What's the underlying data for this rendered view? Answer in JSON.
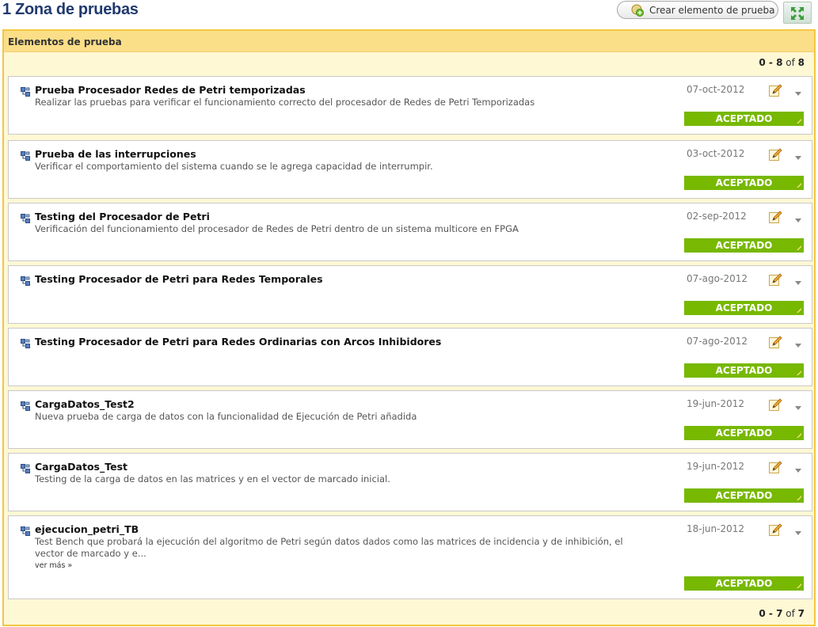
{
  "header": {
    "title": "1 Zona de pruebas",
    "create_button_label": "Crear elemento de prueba"
  },
  "panel": {
    "title": "Elementos de prueba",
    "pager_top": {
      "start": "0",
      "sep": " - ",
      "end": "8",
      "of": " of ",
      "total": "8"
    },
    "pager_bottom": {
      "start": "0",
      "sep": " - ",
      "end": "7",
      "of": " of ",
      "total": "7"
    }
  },
  "items": [
    {
      "title": "Prueba Procesador Redes de Petri temporizadas",
      "description": "Realizar las pruebas para verificar el funcionamiento correcto del procesador de Redes de Petri Temporizadas",
      "date": "07-oct-2012",
      "status": "ACEPTADO"
    },
    {
      "title": "Prueba de las interrupciones",
      "description": "Verificar el comportamiento del sistema cuando se le agrega capacidad de interrumpir.",
      "date": "03-oct-2012",
      "status": "ACEPTADO"
    },
    {
      "title": "Testing del Procesador de Petri",
      "description": "Verificación del funcionamiento del procesador de Redes de Petri dentro de un sistema multicore en FPGA",
      "date": "02-sep-2012",
      "status": "ACEPTADO"
    },
    {
      "title": "Testing Procesador de Petri para Redes Temporales",
      "description": "",
      "date": "07-ago-2012",
      "status": "ACEPTADO"
    },
    {
      "title": "Testing Procesador de Petri para Redes Ordinarias con Arcos Inhibidores",
      "description": "",
      "date": "07-ago-2012",
      "status": "ACEPTADO"
    },
    {
      "title": "CargaDatos_Test2",
      "description": "Nueva prueba de carga de datos con la funcionalidad de Ejecución de Petri añadida",
      "date": "19-jun-2012",
      "status": "ACEPTADO"
    },
    {
      "title": "CargaDatos_Test",
      "description": "Testing de la carga de datos en las matrices y en el vector de marcado inicial.",
      "date": "19-jun-2012",
      "status": "ACEPTADO"
    },
    {
      "title": "ejecucion_petri_TB",
      "description": "Test Bench que probará la ejecución del algoritmo de Petri según datos dados como las matrices de incidencia y de inhibición, el vector de marcado y e...",
      "more": "ver más »",
      "date": "18-jun-2012",
      "status": "ACEPTADO"
    }
  ],
  "colors": {
    "title_blue": "#203a6e",
    "panel_border": "#f2c741",
    "panel_header": "#fbde88",
    "status_green": "#77b800"
  },
  "icons": {
    "create_button": "add-circle-icon",
    "expand_button": "expand-arrows-icon",
    "item": "tree-structure-icon",
    "edit": "pencil-icon",
    "menu": "chevron-down-icon"
  }
}
